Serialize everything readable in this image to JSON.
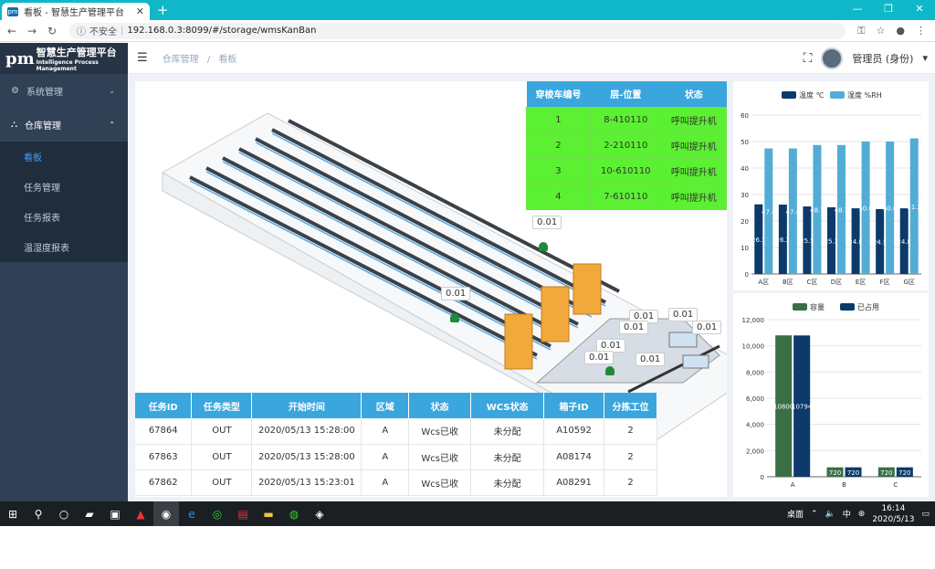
{
  "browser": {
    "tab_title": "看板 - 智慧生产管理平台",
    "favicon_text": "pm",
    "new_tab": "+",
    "insecure_label": "不安全",
    "url": "192.168.0.3:8099/#/storage/wmsKanBan"
  },
  "sidebar": {
    "logo_mark": "pm",
    "logo_title": "智慧生产管理平台",
    "logo_subtitle": "Intelligence Process Management",
    "groups": [
      {
        "label": "系统管理"
      },
      {
        "label": "仓库管理"
      }
    ],
    "items": [
      {
        "label": "看板",
        "active": true
      },
      {
        "label": "任务管理"
      },
      {
        "label": "任务报表"
      },
      {
        "label": "温湿度报表"
      }
    ]
  },
  "header": {
    "breadcrumb": [
      "仓库管理",
      "看板"
    ],
    "separator": "/",
    "user": "管理员 (身份)"
  },
  "shuttle_table": {
    "headers": [
      "穿梭车编号",
      "层-位置",
      "状态"
    ],
    "rows": [
      [
        "1",
        "8-410110",
        "呼叫提升机"
      ],
      [
        "2",
        "2-210110",
        "呼叫提升机"
      ],
      [
        "3",
        "10-610110",
        "呼叫提升机"
      ],
      [
        "4",
        "7-610110",
        "呼叫提升机"
      ]
    ]
  },
  "scene_labels": [
    "0.01",
    "0.01",
    "0.01",
    "0.01",
    "0.01",
    "0.01",
    "0.01",
    "0.01",
    "0.01"
  ],
  "task_table": {
    "headers": [
      "任务ID",
      "任务类型",
      "开始时间",
      "区域",
      "状态",
      "WCS状态",
      "箱子ID",
      "分拣工位"
    ],
    "rows": [
      [
        "67864",
        "OUT",
        "2020/05/13 15:28:00",
        "A",
        "Wcs已收",
        "未分配",
        "A10592",
        "2"
      ],
      [
        "67863",
        "OUT",
        "2020/05/13 15:28:00",
        "A",
        "Wcs已收",
        "未分配",
        "A08174",
        "2"
      ],
      [
        "67862",
        "OUT",
        "2020/05/13 15:23:01",
        "A",
        "Wcs已收",
        "未分配",
        "A08291",
        "2"
      ]
    ]
  },
  "chart_data": [
    {
      "type": "bar",
      "categories": [
        "A区",
        "B区",
        "C区",
        "D区",
        "E区",
        "F区",
        "G区"
      ],
      "series": [
        {
          "name": "温度 ℃",
          "color": "#0b3a6b",
          "values": [
            26.3,
            26.2,
            25.5,
            25.2,
            24.8,
            24.5,
            24.8
          ]
        },
        {
          "name": "湿度 %RH",
          "color": "#52acd6",
          "values": [
            47.4,
            47.4,
            48.7,
            48.7,
            50.0,
            50.0,
            51.2
          ]
        }
      ],
      "data_labels": [
        [
          "26.3",
          "26.2",
          "25.5",
          "25.2",
          "24.8",
          "24.5",
          "24.8"
        ],
        [
          "47.4",
          "47.4",
          "48.7",
          "48.7",
          "50.0",
          "50.0",
          "51.2"
        ]
      ],
      "ylim": [
        0,
        60
      ],
      "yticks": [
        "0",
        "10",
        "20",
        "30",
        "40",
        "50",
        "60"
      ],
      "legend": "top"
    },
    {
      "type": "bar",
      "categories": [
        "A",
        "B",
        "C"
      ],
      "series": [
        {
          "name": "容量",
          "color": "#3a6e45",
          "values": [
            10800,
            720,
            720
          ]
        },
        {
          "name": "已占用",
          "color": "#0b3a6b",
          "values": [
            10794,
            720,
            720
          ]
        }
      ],
      "data_labels": [
        [
          "10800",
          "720",
          "720"
        ],
        [
          "10794",
          "720",
          "720"
        ]
      ],
      "ylim": [
        0,
        12000
      ],
      "yticks": [
        "0",
        "2,000",
        "4,000",
        "6,000",
        "8,000",
        "10,000",
        "12,000"
      ],
      "legend": "top"
    }
  ],
  "taskbar": {
    "desktop_label": "桌面",
    "ime": "中",
    "time": "16:14",
    "date": "2020/5/13"
  }
}
